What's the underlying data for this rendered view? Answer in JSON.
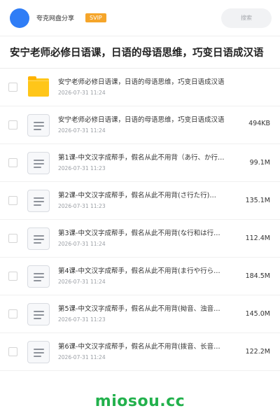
{
  "header": {
    "share_name": "夸克网盘分享",
    "badge": "SVIP",
    "search_placeholder": "搜索"
  },
  "page_title": "安宁老师必修日语课，日语的母语思维，巧变日语成汉语",
  "files": [
    {
      "type": "folder",
      "name": "安宁老师必修日语课，日语的母语思维，巧变日语成汉语",
      "date": "2026-07-31 11:24",
      "size": ""
    },
    {
      "type": "doc",
      "name": "安宁老师必修日语课，日语的母语思维，巧变日语成汉语",
      "date": "2026-07-31 11:24",
      "size": "494KB"
    },
    {
      "type": "doc",
      "name": "第1课-中文汉字成帮手，假名从此不用背（あ行、か行…",
      "date": "2026-07-31 11:23",
      "size": "99.1M"
    },
    {
      "type": "doc",
      "name": "第2课-中文汉字成帮手，假名从此不用背(さ行た行)…",
      "date": "2026-07-31 11:23",
      "size": "135.1M"
    },
    {
      "type": "doc",
      "name": "第3课-中文汉字成帮手，假名从此不用背(な行和は行…",
      "date": "2026-07-31 11:24",
      "size": "112.4M"
    },
    {
      "type": "doc",
      "name": "第4课-中文汉字成帮手，假名从此不用背(ま行や行ら…",
      "date": "2026-07-31 11:24",
      "size": "184.5M"
    },
    {
      "type": "doc",
      "name": "第5课-中文汉字成帮手，假名从此不用背(拗音、浊音…",
      "date": "2026-07-31 11:23",
      "size": "145.0M"
    },
    {
      "type": "doc",
      "name": "第6课-中文汉字成帮手，假名从此不用背(拨音、长音…",
      "date": "2026-07-31 11:24",
      "size": "122.2M"
    }
  ],
  "watermark": "miosou.cc",
  "colors": {
    "avatar": "#2f7df6",
    "svip_badge": "#f5a52a",
    "folder": "#ffc619",
    "watermark": "#22b14c"
  },
  "icons": {
    "folder": "folder-icon",
    "doc": "document-icon"
  }
}
